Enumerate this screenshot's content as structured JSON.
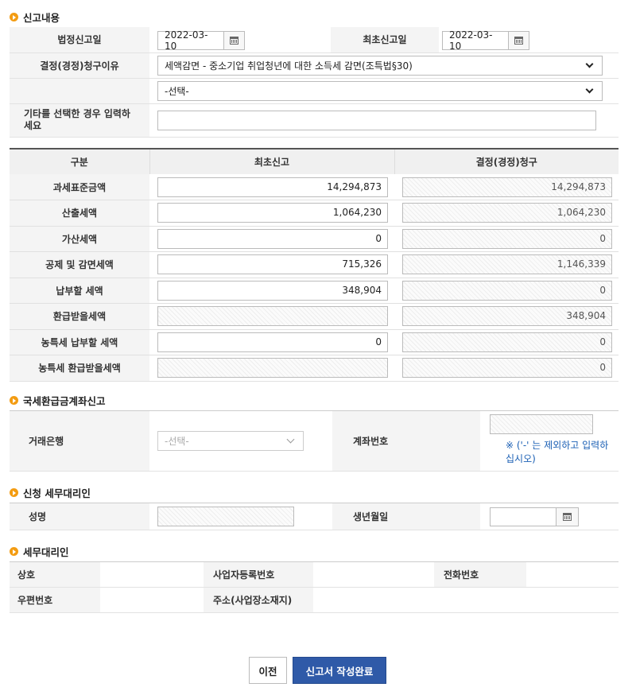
{
  "section1": {
    "title": "신고내용",
    "legal_date_label": "법정신고일",
    "legal_date_value": "2022-03-10",
    "first_date_label": "최초신고일",
    "first_date_value": "2022-03-10",
    "reason_label": "결정(경정)청구이유",
    "reason_value": "세액감면 - 중소기업 취업청년에 대한 소득세 감면(조특법§30)",
    "reason2_value": "-선택-",
    "other_label": "기타를 선택한 경우 입력하세요",
    "other_value": ""
  },
  "grid": {
    "headers": [
      "구분",
      "최초신고",
      "결정(경정)청구"
    ],
    "rows": [
      {
        "label": "과세표준금액",
        "initial": "14,294,873",
        "claim": "14,294,873"
      },
      {
        "label": "산출세액",
        "initial": "1,064,230",
        "claim": "1,064,230"
      },
      {
        "label": "가산세액",
        "initial": "0",
        "claim": "0"
      },
      {
        "label": "공제 및 감면세액",
        "initial": "715,326",
        "claim": "1,146,339"
      },
      {
        "label": "납부할 세액",
        "initial": "348,904",
        "claim": "0"
      },
      {
        "label": "환급받을세액",
        "initial": "",
        "claim": "348,904"
      },
      {
        "label": "농특세 납부할 세액",
        "initial": "0",
        "claim": "0"
      },
      {
        "label": "농특세 환급받을세액",
        "initial": "",
        "claim": "0"
      }
    ]
  },
  "section2": {
    "title": "국세환급금계좌신고",
    "bank_label": "거래은행",
    "bank_value": "-선택-",
    "account_label": "계좌번호",
    "account_value": "",
    "note": "※ ('-' 는 제외하고 입력하십시오)"
  },
  "section3": {
    "title": "신청 세무대리인",
    "name_label": "성명",
    "name_value": "",
    "birth_label": "생년월일",
    "birth_value": ""
  },
  "section4": {
    "title": "세무대리인",
    "company_label": "상호",
    "company_value": "",
    "bizno_label": "사업자등록번호",
    "bizno_value": "",
    "phone_label": "전화번호",
    "phone_value": "",
    "zip_label": "우편번호",
    "zip_value": "",
    "addr_label": "주소(사업장소재지)",
    "addr_value": ""
  },
  "buttons": {
    "prev": "이전",
    "complete": "신고서 작성완료"
  },
  "colors": {
    "accent_orange": "#f39c12",
    "primary_button": "#2f5aa8",
    "note_blue": "#1a5fb4"
  }
}
